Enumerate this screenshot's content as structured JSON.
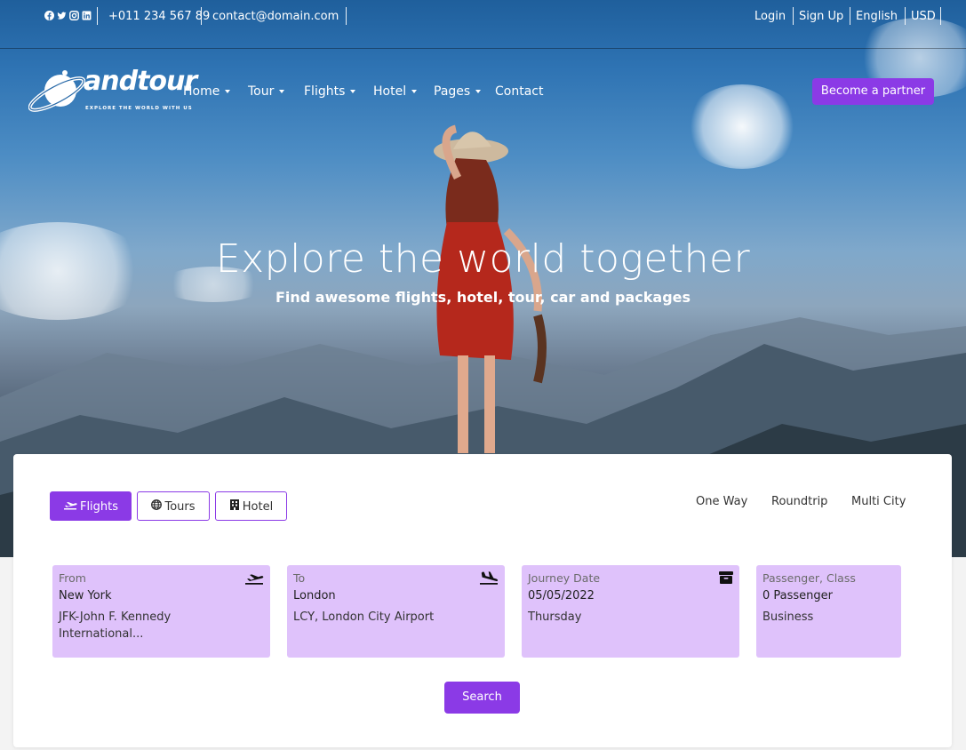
{
  "topbar": {
    "social_icons": [
      "facebook-icon",
      "twitter-icon",
      "instagram-icon",
      "linkedin-icon"
    ],
    "phone": "+011 234 567 89",
    "email": "contact@domain.com",
    "login": "Login",
    "signup": "Sign Up",
    "language": "English",
    "currency": "USD"
  },
  "brand": {
    "name": "andtour",
    "tagline": "EXPLORE THE WORLD WITH US"
  },
  "nav": {
    "items": [
      {
        "label": "Home",
        "dropdown": true
      },
      {
        "label": "Tour",
        "dropdown": true
      },
      {
        "label": "Flights",
        "dropdown": true
      },
      {
        "label": "Hotel",
        "dropdown": true
      },
      {
        "label": "Pages",
        "dropdown": true
      },
      {
        "label": "Contact",
        "dropdown": false
      }
    ],
    "cta": "Become a partner"
  },
  "hero": {
    "title": "Explore the world together",
    "subtitle": "Find awesome flights, hotel, tour, car and packages"
  },
  "search": {
    "tabs": [
      {
        "label": "Flights",
        "icon": "plane-icon",
        "active": true
      },
      {
        "label": "Tours",
        "icon": "globe-icon",
        "active": false
      },
      {
        "label": "Hotel",
        "icon": "building-icon",
        "active": false
      }
    ],
    "trip_types": [
      "One Way",
      "Roundtrip",
      "Multi City"
    ],
    "fields": {
      "from": {
        "label": "From",
        "value": "New York",
        "sub": "JFK-John F. Kennedy International...",
        "icon": "plane-departure-icon"
      },
      "to": {
        "label": "To",
        "value": "London",
        "sub": "LCY, London City Airport",
        "icon": "plane-arrival-icon"
      },
      "date": {
        "label": "Journey Date",
        "value": "05/05/2022",
        "sub": "Thursday",
        "icon": "calendar-icon"
      },
      "passenger": {
        "label": "Passenger, Class",
        "value": "0 Passenger",
        "sub": "Business"
      }
    },
    "button": "Search"
  },
  "colors": {
    "accent": "#8b3ae6",
    "field_bg": "#dfc2fb"
  }
}
